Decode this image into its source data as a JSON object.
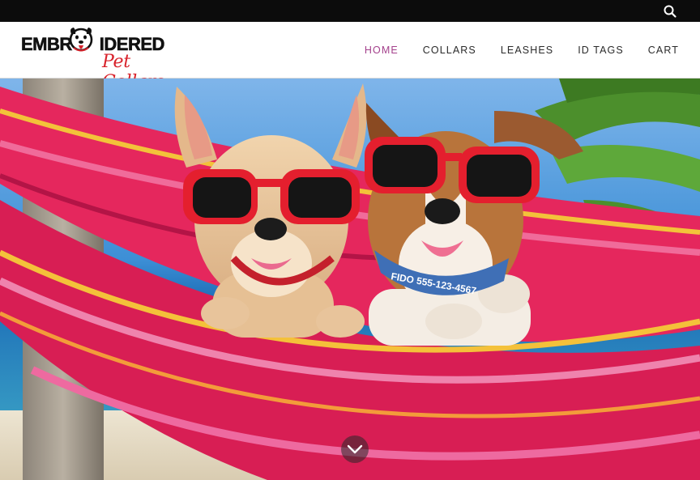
{
  "topbar": {
    "search_icon": "search-icon"
  },
  "header": {
    "logo": {
      "line1": "EMBR",
      "line1b": "IDERED",
      "line2": "Pet Collars"
    },
    "nav": [
      {
        "label": "HOME",
        "active": true
      },
      {
        "label": "COLLARS",
        "active": false
      },
      {
        "label": "LEASHES",
        "active": false
      },
      {
        "label": "ID TAGS",
        "active": false
      },
      {
        "label": "CART",
        "active": false
      }
    ]
  },
  "hero": {
    "collar_text": "FIDO 555-123-4567",
    "scroll_icon": "chevron-down-icon"
  },
  "colors": {
    "accent": "#a4418c",
    "logo_red": "#d8222b",
    "topbar": "#0c0c0c"
  }
}
